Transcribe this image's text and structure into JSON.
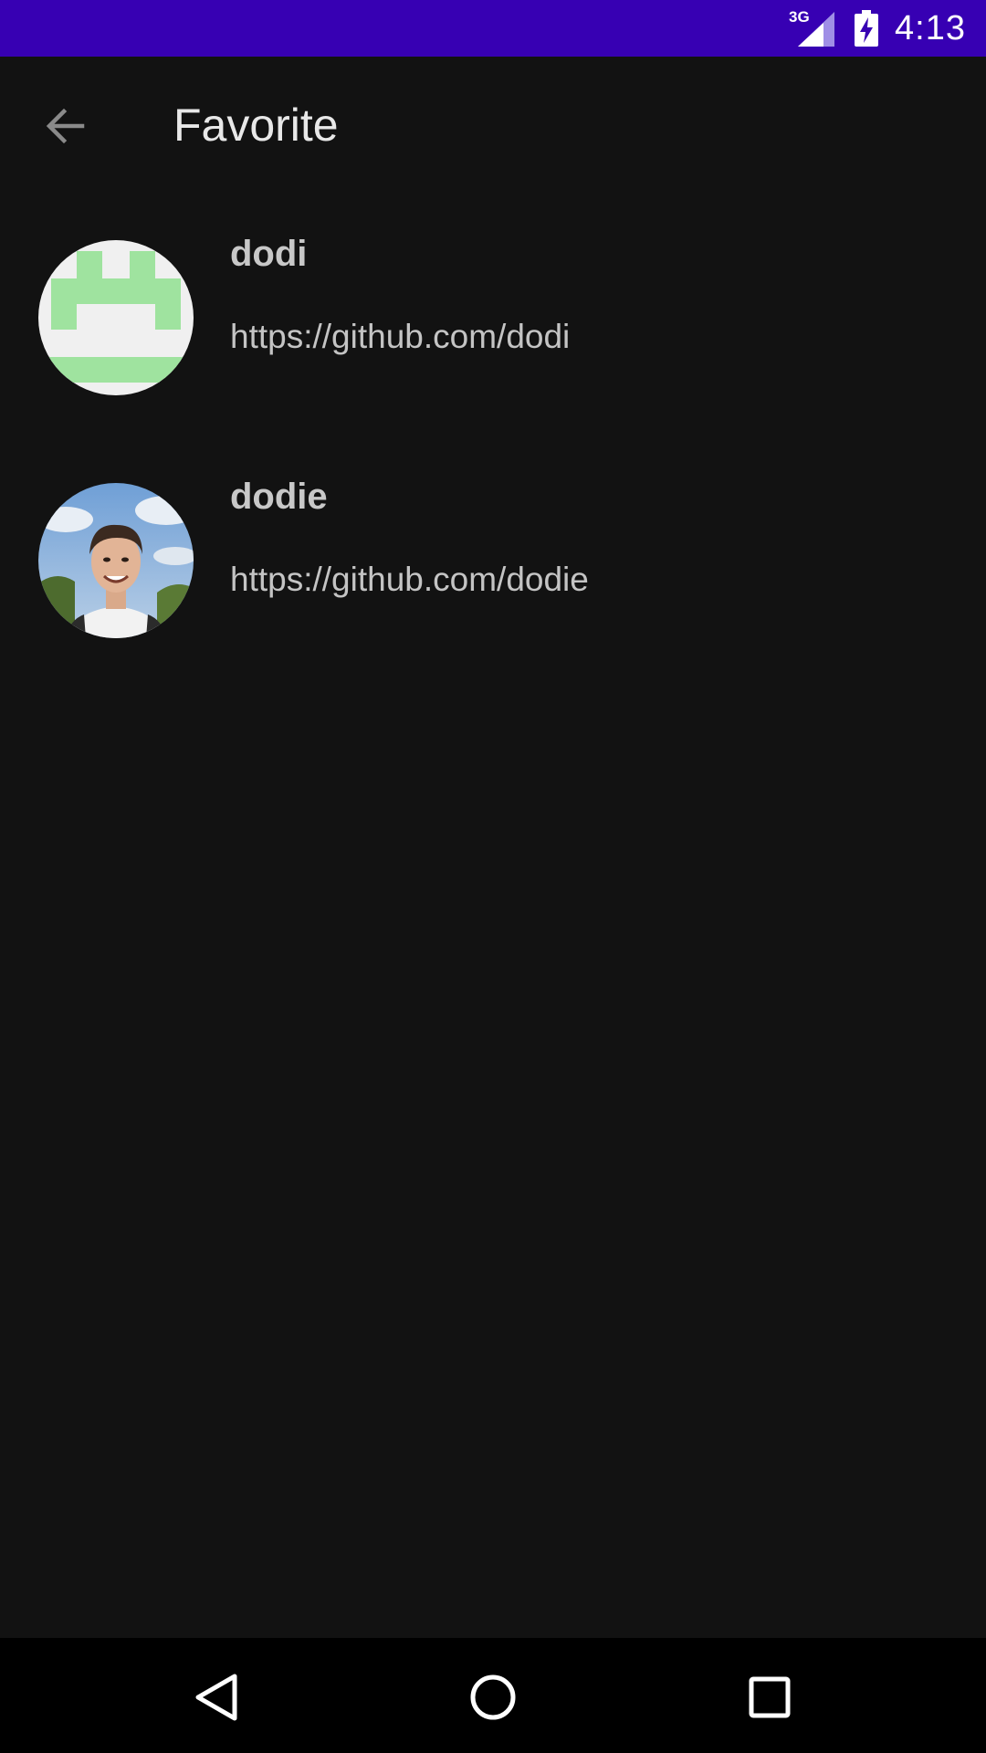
{
  "status_bar": {
    "network": "3G",
    "time": "4:13",
    "icons": [
      "signal-icon",
      "battery-charging-icon"
    ]
  },
  "app_bar": {
    "title": "Favorite",
    "back_icon": "arrow-back-icon"
  },
  "favorites": [
    {
      "username": "dodi",
      "url": "https://github.com/dodi",
      "avatar": "identicon-avatar"
    },
    {
      "username": "dodie",
      "url": "https://github.com/dodie",
      "avatar": "photo-avatar"
    }
  ],
  "nav_bar": {
    "icons": [
      "back-triangle-icon",
      "home-circle-icon",
      "recents-square-icon"
    ]
  },
  "colors": {
    "status_bar": "#3700b3",
    "background": "#121212",
    "identicon_green": "#9fe39f"
  }
}
